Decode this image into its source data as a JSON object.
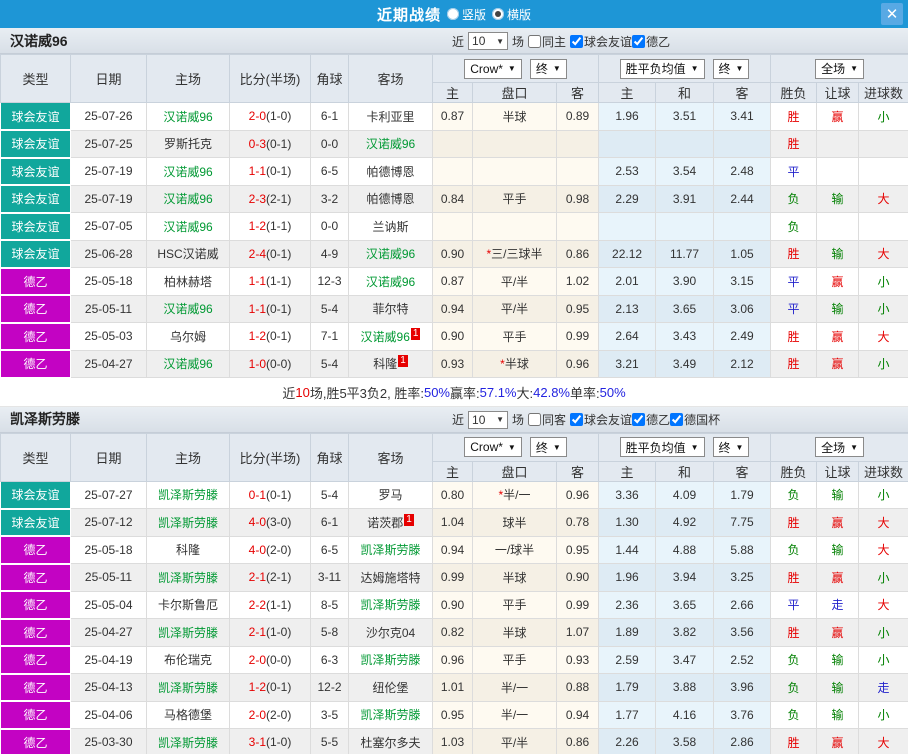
{
  "colors": {
    "topbar_blue": "#1e96d6",
    "close_button_blue": "#58a9e4",
    "friendly_teal": "#11a79c",
    "league_magenta": "#c303c3",
    "win_red": "#e60000",
    "draw_blue": "#2323cc",
    "lose_green": "#008000",
    "focus_team_green": "#009933"
  },
  "titlebar": {
    "title": "近期战绩",
    "portrait_label": "竖版",
    "landscape_label": "横版",
    "portrait_selected": false,
    "landscape_selected": true,
    "close_label": "✕"
  },
  "table_header": {
    "col_type": "类型",
    "col_date": "日期",
    "col_home": "主场",
    "col_score": "比分(半场)",
    "col_corner": "角球",
    "col_away": "客场",
    "crow_select": "Crow*",
    "final_select": "终",
    "avg_select": "胜平负均值",
    "fullmatch_select": "全场",
    "sub_home": "主",
    "sub_handicap": "盘口",
    "sub_away": "客",
    "sub_avg_home": "主",
    "sub_avg_draw": "和",
    "sub_avg_away": "客",
    "sub_result": "胜负",
    "sub_handicap_result": "让球",
    "sub_goals": "进球数"
  },
  "sections": [
    {
      "team": "汉诺威96",
      "filter": {
        "near": "近",
        "count": "10",
        "games": "场",
        "same": {
          "label": "同主",
          "checked": false
        },
        "comps": [
          {
            "label": "球会友谊",
            "checked": true
          },
          {
            "label": "德乙",
            "checked": true
          }
        ]
      },
      "rows": [
        {
          "type": "球会友谊",
          "date": "25-07-26",
          "home": "汉诺威96",
          "home_focus": true,
          "home_badge": "",
          "score": "2-0",
          "half": "(1-0)",
          "corner": "6-1",
          "away": "卡利亚里",
          "away_focus": false,
          "away_badge": "",
          "odds_home": "0.87",
          "handicap": "半球",
          "handicap_star": false,
          "odds_away": "0.89",
          "avg_home": "1.96",
          "avg_draw": "3.51",
          "avg_away": "3.41",
          "result": "胜",
          "result_color": "red",
          "handicap_result": "赢",
          "handicap_result_color": "red",
          "goals": "小",
          "goals_color": "green"
        },
        {
          "type": "球会友谊",
          "date": "25-07-25",
          "home": "罗斯托克",
          "home_focus": false,
          "home_badge": "",
          "score": "0-3",
          "half": "(0-1)",
          "corner": "0-0",
          "away": "汉诺威96",
          "away_focus": true,
          "away_badge": "",
          "odds_home": "",
          "handicap": "",
          "handicap_star": false,
          "odds_away": "",
          "avg_home": "",
          "avg_draw": "",
          "avg_away": "",
          "result": "胜",
          "result_color": "red",
          "handicap_result": "",
          "handicap_result_color": "",
          "goals": "",
          "goals_color": ""
        },
        {
          "type": "球会友谊",
          "date": "25-07-19",
          "home": "汉诺威96",
          "home_focus": true,
          "home_badge": "",
          "score": "1-1",
          "half": "(0-1)",
          "corner": "6-5",
          "away": "帕德博恩",
          "away_focus": false,
          "away_badge": "",
          "odds_home": "",
          "handicap": "",
          "handicap_star": false,
          "odds_away": "",
          "avg_home": "2.53",
          "avg_draw": "3.54",
          "avg_away": "2.48",
          "result": "平",
          "result_color": "blue",
          "handicap_result": "",
          "handicap_result_color": "",
          "goals": "",
          "goals_color": ""
        },
        {
          "type": "球会友谊",
          "date": "25-07-19",
          "home": "汉诺威96",
          "home_focus": true,
          "home_badge": "",
          "score": "2-3",
          "half": "(2-1)",
          "corner": "3-2",
          "away": "帕德博恩",
          "away_focus": false,
          "away_badge": "",
          "odds_home": "0.84",
          "handicap": "平手",
          "handicap_star": false,
          "odds_away": "0.98",
          "avg_home": "2.29",
          "avg_draw": "3.91",
          "avg_away": "2.44",
          "result": "负",
          "result_color": "green",
          "handicap_result": "输",
          "handicap_result_color": "green",
          "goals": "大",
          "goals_color": "red"
        },
        {
          "type": "球会友谊",
          "date": "25-07-05",
          "home": "汉诺威96",
          "home_focus": true,
          "home_badge": "",
          "score": "1-2",
          "half": "(1-1)",
          "corner": "0-0",
          "away": "兰讷斯",
          "away_focus": false,
          "away_badge": "",
          "odds_home": "",
          "handicap": "",
          "handicap_star": false,
          "odds_away": "",
          "avg_home": "",
          "avg_draw": "",
          "avg_away": "",
          "result": "负",
          "result_color": "green",
          "handicap_result": "",
          "handicap_result_color": "",
          "goals": "",
          "goals_color": ""
        },
        {
          "type": "球会友谊",
          "date": "25-06-28",
          "home": "HSC汉诺威",
          "home_focus": false,
          "home_badge": "",
          "score": "2-4",
          "half": "(0-1)",
          "corner": "4-9",
          "away": "汉诺威96",
          "away_focus": true,
          "away_badge": "",
          "odds_home": "0.90",
          "handicap": "三/三球半",
          "handicap_star": true,
          "odds_away": "0.86",
          "avg_home": "22.12",
          "avg_draw": "11.77",
          "avg_away": "1.05",
          "result": "胜",
          "result_color": "red",
          "handicap_result": "输",
          "handicap_result_color": "green",
          "goals": "大",
          "goals_color": "red"
        },
        {
          "type": "德乙",
          "date": "25-05-18",
          "home": "柏林赫塔",
          "home_focus": false,
          "home_badge": "",
          "score": "1-1",
          "half": "(1-1)",
          "corner": "12-3",
          "away": "汉诺威96",
          "away_focus": true,
          "away_badge": "",
          "odds_home": "0.87",
          "handicap": "平/半",
          "handicap_star": false,
          "odds_away": "1.02",
          "avg_home": "2.01",
          "avg_draw": "3.90",
          "avg_away": "3.15",
          "result": "平",
          "result_color": "blue",
          "handicap_result": "赢",
          "handicap_result_color": "red",
          "goals": "小",
          "goals_color": "green"
        },
        {
          "type": "德乙",
          "date": "25-05-11",
          "home": "汉诺威96",
          "home_focus": true,
          "home_badge": "",
          "score": "1-1",
          "half": "(0-1)",
          "corner": "5-4",
          "away": "菲尔特",
          "away_focus": false,
          "away_badge": "",
          "odds_home": "0.94",
          "handicap": "平/半",
          "handicap_star": false,
          "odds_away": "0.95",
          "avg_home": "2.13",
          "avg_draw": "3.65",
          "avg_away": "3.06",
          "result": "平",
          "result_color": "blue",
          "handicap_result": "输",
          "handicap_result_color": "green",
          "goals": "小",
          "goals_color": "green"
        },
        {
          "type": "德乙",
          "date": "25-05-03",
          "home": "乌尔姆",
          "home_focus": false,
          "home_badge": "",
          "score": "1-2",
          "half": "(0-1)",
          "corner": "7-1",
          "away": "汉诺威96",
          "away_focus": true,
          "away_badge": "1",
          "odds_home": "0.90",
          "handicap": "平手",
          "handicap_star": false,
          "odds_away": "0.99",
          "avg_home": "2.64",
          "avg_draw": "3.43",
          "avg_away": "2.49",
          "result": "胜",
          "result_color": "red",
          "handicap_result": "赢",
          "handicap_result_color": "red",
          "goals": "大",
          "goals_color": "red"
        },
        {
          "type": "德乙",
          "date": "25-04-27",
          "home": "汉诺威96",
          "home_focus": true,
          "home_badge": "",
          "score": "1-0",
          "half": "(0-0)",
          "corner": "5-4",
          "away": "科隆",
          "away_focus": false,
          "away_badge": "1",
          "odds_home": "0.93",
          "handicap": "半球",
          "handicap_star": true,
          "odds_away": "0.96",
          "avg_home": "3.21",
          "avg_draw": "3.49",
          "avg_away": "2.12",
          "result": "胜",
          "result_color": "red",
          "handicap_result": "赢",
          "handicap_result_color": "red",
          "goals": "小",
          "goals_color": "green"
        }
      ],
      "summary": [
        {
          "text": "近",
          "color": "dark"
        },
        {
          "text": "10",
          "color": "red"
        },
        {
          "text": "场,胜5平3负2, 胜率:",
          "color": "dark"
        },
        {
          "text": "50%",
          "color": "blue"
        },
        {
          "text": " 赢率:",
          "color": "dark"
        },
        {
          "text": "57.1%",
          "color": "blue"
        },
        {
          "text": " 大:",
          "color": "dark"
        },
        {
          "text": "42.8%",
          "color": "blue"
        },
        {
          "text": " 单率:",
          "color": "dark"
        },
        {
          "text": "50%",
          "color": "blue"
        }
      ]
    },
    {
      "team": "凯泽斯劳滕",
      "filter": {
        "near": "近",
        "count": "10",
        "games": "场",
        "same": {
          "label": "同客",
          "checked": false
        },
        "comps": [
          {
            "label": "球会友谊",
            "checked": true
          },
          {
            "label": "德乙",
            "checked": true
          },
          {
            "label": "德国杯",
            "checked": true
          }
        ]
      },
      "rows": [
        {
          "type": "球会友谊",
          "date": "25-07-27",
          "home": "凯泽斯劳滕",
          "home_focus": true,
          "home_badge": "",
          "score": "0-1",
          "half": "(0-1)",
          "corner": "5-4",
          "away": "罗马",
          "away_focus": false,
          "away_badge": "",
          "odds_home": "0.80",
          "handicap": "半/一",
          "handicap_star": true,
          "odds_away": "0.96",
          "avg_home": "3.36",
          "avg_draw": "4.09",
          "avg_away": "1.79",
          "result": "负",
          "result_color": "green",
          "handicap_result": "输",
          "handicap_result_color": "green",
          "goals": "小",
          "goals_color": "green"
        },
        {
          "type": "球会友谊",
          "date": "25-07-12",
          "home": "凯泽斯劳滕",
          "home_focus": true,
          "home_badge": "",
          "score": "4-0",
          "half": "(3-0)",
          "corner": "6-1",
          "away": "诺茨郡",
          "away_focus": false,
          "away_badge": "1",
          "odds_home": "1.04",
          "handicap": "球半",
          "handicap_star": false,
          "odds_away": "0.78",
          "avg_home": "1.30",
          "avg_draw": "4.92",
          "avg_away": "7.75",
          "result": "胜",
          "result_color": "red",
          "handicap_result": "赢",
          "handicap_result_color": "red",
          "goals": "大",
          "goals_color": "red"
        },
        {
          "type": "德乙",
          "date": "25-05-18",
          "home": "科隆",
          "home_focus": false,
          "home_badge": "",
          "score": "4-0",
          "half": "(2-0)",
          "corner": "6-5",
          "away": "凯泽斯劳滕",
          "away_focus": true,
          "away_badge": "",
          "odds_home": "0.94",
          "handicap": "一/球半",
          "handicap_star": false,
          "odds_away": "0.95",
          "avg_home": "1.44",
          "avg_draw": "4.88",
          "avg_away": "5.88",
          "result": "负",
          "result_color": "green",
          "handicap_result": "输",
          "handicap_result_color": "green",
          "goals": "大",
          "goals_color": "red"
        },
        {
          "type": "德乙",
          "date": "25-05-11",
          "home": "凯泽斯劳滕",
          "home_focus": true,
          "home_badge": "",
          "score": "2-1",
          "half": "(2-1)",
          "corner": "3-11",
          "away": "达姆施塔特",
          "away_focus": false,
          "away_badge": "",
          "odds_home": "0.99",
          "handicap": "半球",
          "handicap_star": false,
          "odds_away": "0.90",
          "avg_home": "1.96",
          "avg_draw": "3.94",
          "avg_away": "3.25",
          "result": "胜",
          "result_color": "red",
          "handicap_result": "赢",
          "handicap_result_color": "red",
          "goals": "小",
          "goals_color": "green"
        },
        {
          "type": "德乙",
          "date": "25-05-04",
          "home": "卡尔斯鲁厄",
          "home_focus": false,
          "home_badge": "",
          "score": "2-2",
          "half": "(1-1)",
          "corner": "8-5",
          "away": "凯泽斯劳滕",
          "away_focus": true,
          "away_badge": "",
          "odds_home": "0.90",
          "handicap": "平手",
          "handicap_star": false,
          "odds_away": "0.99",
          "avg_home": "2.36",
          "avg_draw": "3.65",
          "avg_away": "2.66",
          "result": "平",
          "result_color": "blue",
          "handicap_result": "走",
          "handicap_result_color": "blue",
          "goals": "大",
          "goals_color": "red"
        },
        {
          "type": "德乙",
          "date": "25-04-27",
          "home": "凯泽斯劳滕",
          "home_focus": true,
          "home_badge": "",
          "score": "2-1",
          "half": "(1-0)",
          "corner": "5-8",
          "away": "沙尔克04",
          "away_focus": false,
          "away_badge": "",
          "odds_home": "0.82",
          "handicap": "半球",
          "handicap_star": false,
          "odds_away": "1.07",
          "avg_home": "1.89",
          "avg_draw": "3.82",
          "avg_away": "3.56",
          "result": "胜",
          "result_color": "red",
          "handicap_result": "赢",
          "handicap_result_color": "red",
          "goals": "小",
          "goals_color": "green"
        },
        {
          "type": "德乙",
          "date": "25-04-19",
          "home": "布伦瑞克",
          "home_focus": false,
          "home_badge": "",
          "score": "2-0",
          "half": "(0-0)",
          "corner": "6-3",
          "away": "凯泽斯劳滕",
          "away_focus": true,
          "away_badge": "",
          "odds_home": "0.96",
          "handicap": "平手",
          "handicap_star": false,
          "odds_away": "0.93",
          "avg_home": "2.59",
          "avg_draw": "3.47",
          "avg_away": "2.52",
          "result": "负",
          "result_color": "green",
          "handicap_result": "输",
          "handicap_result_color": "green",
          "goals": "小",
          "goals_color": "green"
        },
        {
          "type": "德乙",
          "date": "25-04-13",
          "home": "凯泽斯劳滕",
          "home_focus": true,
          "home_badge": "",
          "score": "1-2",
          "half": "(0-1)",
          "corner": "12-2",
          "away": "纽伦堡",
          "away_focus": false,
          "away_badge": "",
          "odds_home": "1.01",
          "handicap": "半/一",
          "handicap_star": false,
          "odds_away": "0.88",
          "avg_home": "1.79",
          "avg_draw": "3.88",
          "avg_away": "3.96",
          "result": "负",
          "result_color": "green",
          "handicap_result": "输",
          "handicap_result_color": "green",
          "goals": "走",
          "goals_color": "blue"
        },
        {
          "type": "德乙",
          "date": "25-04-06",
          "home": "马格德堡",
          "home_focus": false,
          "home_badge": "",
          "score": "2-0",
          "half": "(2-0)",
          "corner": "3-5",
          "away": "凯泽斯劳滕",
          "away_focus": true,
          "away_badge": "",
          "odds_home": "0.95",
          "handicap": "半/一",
          "handicap_star": false,
          "odds_away": "0.94",
          "avg_home": "1.77",
          "avg_draw": "4.16",
          "avg_away": "3.76",
          "result": "负",
          "result_color": "green",
          "handicap_result": "输",
          "handicap_result_color": "green",
          "goals": "小",
          "goals_color": "green"
        },
        {
          "type": "德乙",
          "date": "25-03-30",
          "home": "凯泽斯劳滕",
          "home_focus": true,
          "home_badge": "",
          "score": "3-1",
          "half": "(1-0)",
          "corner": "5-5",
          "away": "杜塞尔多夫",
          "away_focus": false,
          "away_badge": "",
          "odds_home": "1.03",
          "handicap": "平/半",
          "handicap_star": false,
          "odds_away": "0.86",
          "avg_home": "2.26",
          "avg_draw": "3.58",
          "avg_away": "2.86",
          "result": "胜",
          "result_color": "red",
          "handicap_result": "赢",
          "handicap_result_color": "red",
          "goals": "大",
          "goals_color": "red"
        }
      ],
      "summary": null
    }
  ]
}
